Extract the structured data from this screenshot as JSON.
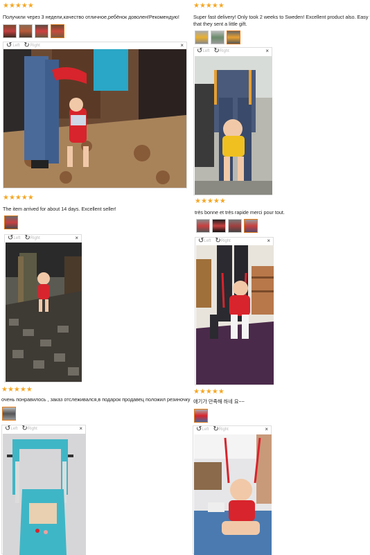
{
  "reviews": [
    {
      "stars": "★★★★★",
      "text": "Получили через 3 недели,качество отличное,ребёнок доволен!Рекомендую!",
      "viewer": {
        "left_label": "Left",
        "right_label": "Right",
        "close": "×",
        "rotate_left_icon": "rotate-left-icon",
        "rotate_right_icon": "rotate-right-icon"
      }
    },
    {
      "stars": "★★★★★",
      "text_line1": "Super fast delivery! Only took 2 weeks to Sweden! Excellent product also. Easy to",
      "text_line2": "that they sent a little gift.",
      "viewer": {
        "left_label": "Left",
        "right_label": "Right",
        "close": "×"
      }
    },
    {
      "stars": "★★★★★",
      "text": "The item arrived for about 14 days. Excellent seller!",
      "viewer": {
        "left_label": "Left",
        "right_label": "Right",
        "close": "×"
      }
    },
    {
      "stars": "★★★★★",
      "text": "très bonne et très rapide merci pour tout.",
      "viewer": {
        "left_label": "Left",
        "right_label": "Right",
        "close": "×"
      }
    },
    {
      "stars": "★★★★★",
      "text": "очень понравилось , заказ отслеживался,в подарок продавец положил резиночку",
      "viewer": {
        "left_label": "Left",
        "right_label": "Right",
        "close": "×"
      }
    },
    {
      "stars": "★★★★★",
      "text": "애기가 만족해 하네 요~~",
      "viewer": {
        "left_label": "Left",
        "right_label": "Right",
        "close": "×"
      }
    }
  ],
  "colors": {
    "star": "#f5a623",
    "thumb_active": "#e07a1a",
    "harness_red": "#d8242c",
    "harness_teal": "#3fb6c6"
  }
}
